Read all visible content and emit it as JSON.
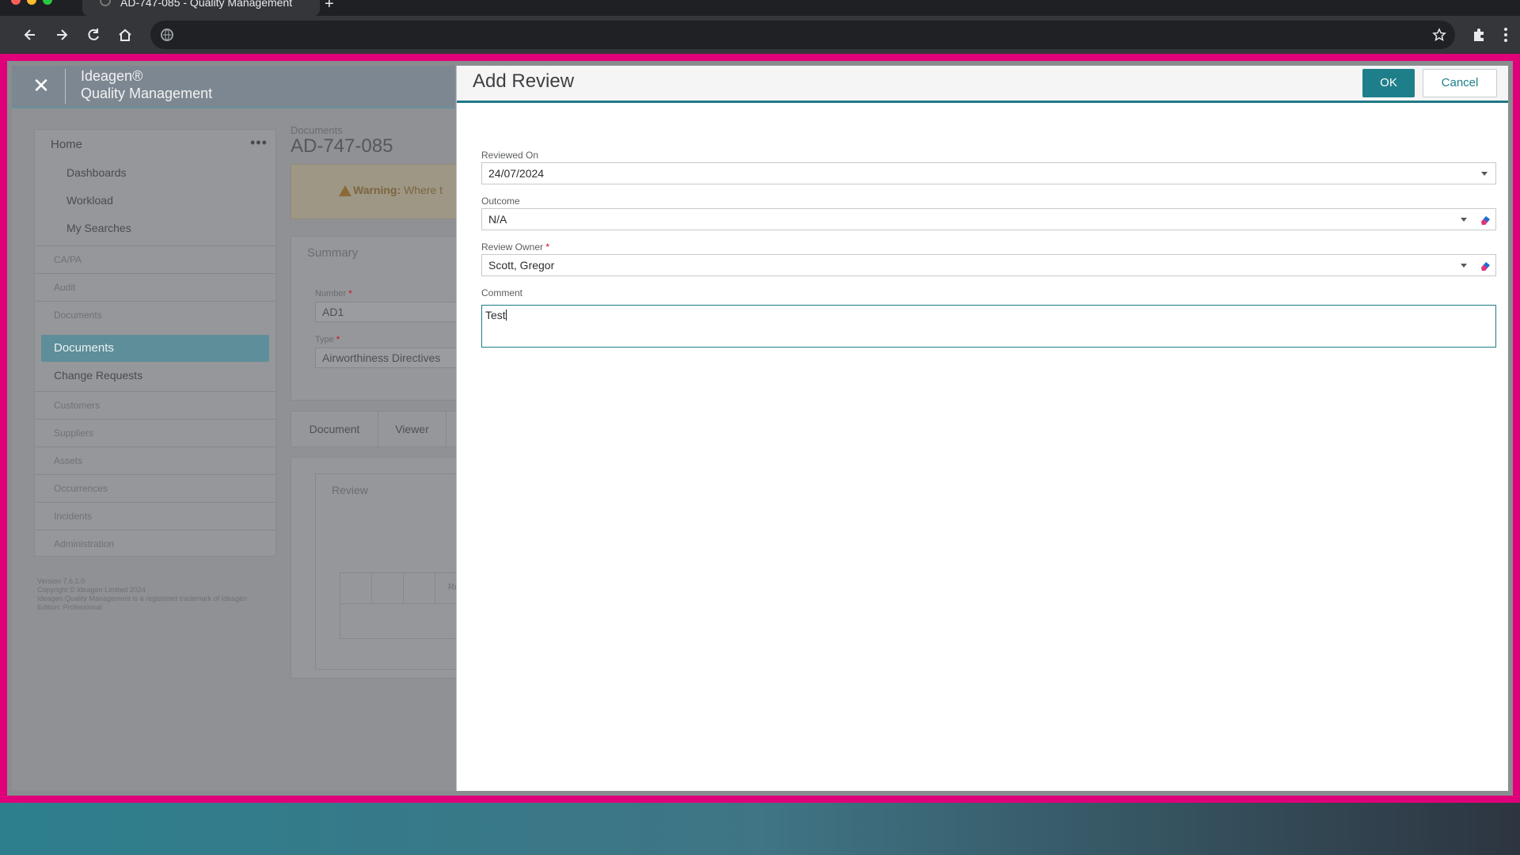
{
  "browser": {
    "tab_title": "AD-747-085 - Quality Management",
    "new_tab_glyph": "+"
  },
  "colors": {
    "accent": "#1e7f8a",
    "frame_highlight": "#e0007a",
    "required": "#d0021b"
  },
  "app": {
    "brand_line1": "Ideagen®",
    "brand_line2": "Quality Management",
    "close_glyph": "✕"
  },
  "sidebar": {
    "home": "Home",
    "more_glyph": "•••",
    "sub_items": [
      "Dashboards",
      "Workload",
      "My Searches"
    ],
    "sections": [
      "CA/PA",
      "Audit",
      "Documents"
    ],
    "active_item": "Documents",
    "change_requests": "Change Requests",
    "more_sections": [
      "Customers",
      "Suppliers",
      "Assets",
      "Occurrences",
      "Incidents",
      "Administration"
    ],
    "footer": [
      "Version 7.6.1.0",
      "Copyright © Ideagen Limited 2024",
      "Ideagen Quality Management is a registered trademark of Ideagen",
      "Edition: Professional"
    ]
  },
  "document": {
    "kicker": "Documents",
    "title": "AD-747-085",
    "warning_label": "Warning:",
    "warning_text": "Where t",
    "summary_title": "Summary",
    "number_label": "Number",
    "number_value": "AD1",
    "type_label": "Type",
    "type_value": "Airworthiness Directives",
    "tabs": [
      "Document",
      "Viewer"
    ],
    "review_label": "Review",
    "grid_text": "Re"
  },
  "modal": {
    "title": "Add Review",
    "ok_label": "OK",
    "cancel_label": "Cancel",
    "reviewed_on_label": "Reviewed On",
    "reviewed_on_value": "24/07/2024",
    "outcome_label": "Outcome",
    "outcome_value": "N/A",
    "review_owner_label": "Review Owner",
    "review_owner_value": "Scott, Gregor",
    "required_marker": "*",
    "comment_label": "Comment",
    "comment_value": "Test"
  }
}
